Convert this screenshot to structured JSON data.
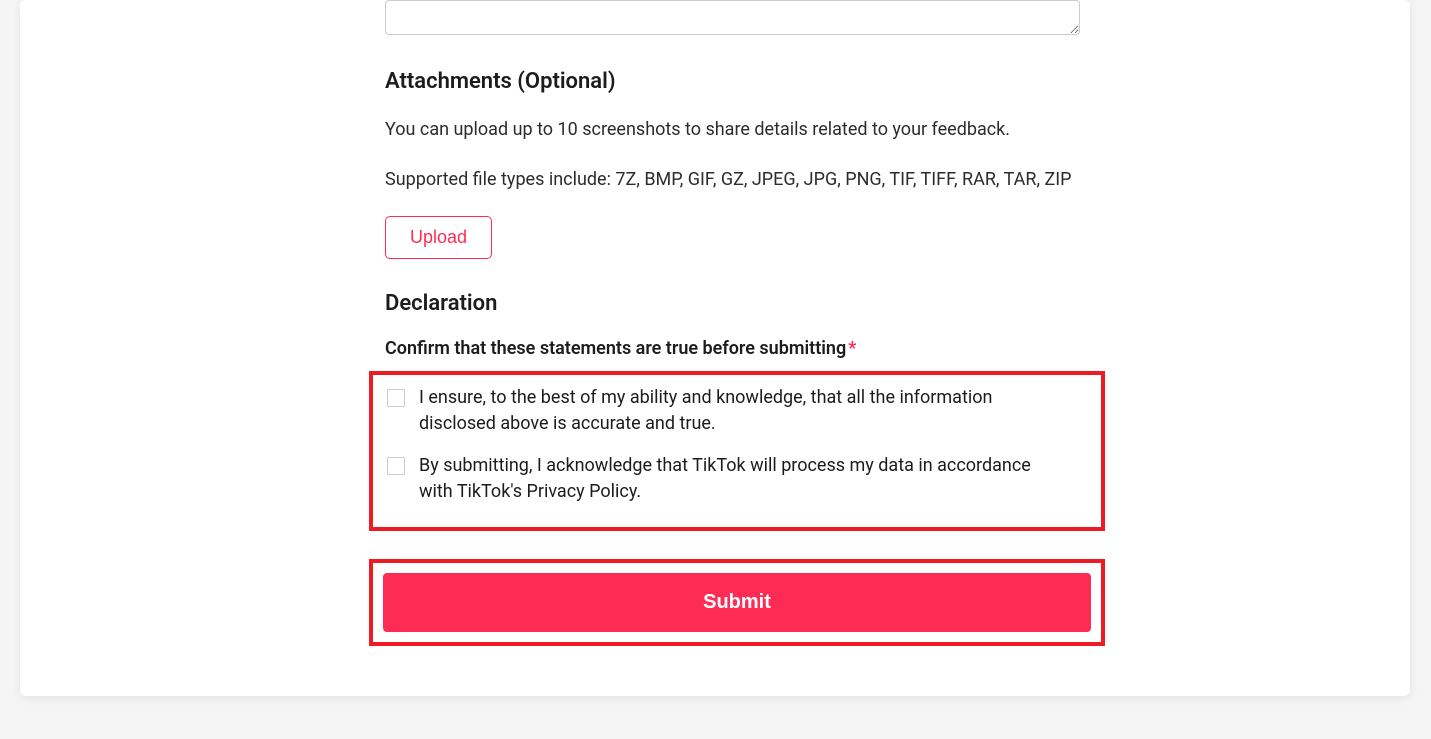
{
  "attachments": {
    "heading": "Attachments (Optional)",
    "help1": "You can upload up to 10 screenshots to share details related to your feedback.",
    "help2": "Supported file types include: 7Z, BMP, GIF, GZ, JPEG, JPG, PNG, TIF, TIFF, RAR, TAR, ZIP",
    "upload_label": "Upload"
  },
  "declaration": {
    "heading": "Declaration",
    "confirm_label": "Confirm that these statements are true before submitting",
    "required_mark": "*",
    "checkbox1_text": "I ensure, to the best of my ability and knowledge, that all the information disclosed above is accurate and true.",
    "checkbox2_text": "By submitting, I acknowledge that TikTok will process my data in accordance with TikTok's Privacy Policy."
  },
  "submit": {
    "label": "Submit"
  }
}
